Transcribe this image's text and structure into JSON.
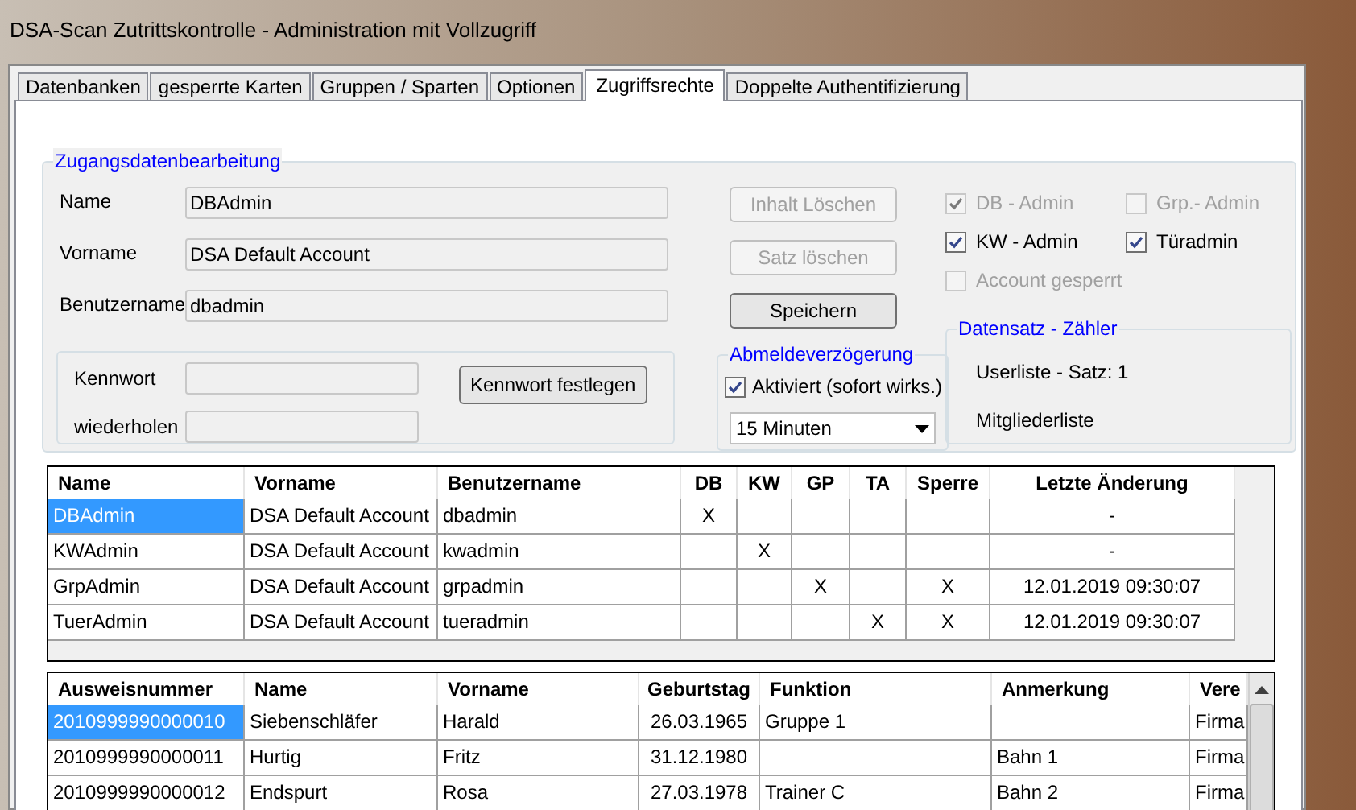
{
  "window": {
    "title": "DSA-Scan Zutrittskontrolle - Administration mit Vollzugriff"
  },
  "tabs": [
    {
      "label": "Datenbanken",
      "selected": false
    },
    {
      "label": "gesperrte Karten",
      "selected": false
    },
    {
      "label": "Gruppen / Sparten",
      "selected": false
    },
    {
      "label": "Optionen",
      "selected": false
    },
    {
      "label": "Zugriffsrechte",
      "selected": true
    },
    {
      "label": "Doppelte Authentifizierung",
      "selected": false
    }
  ],
  "editor": {
    "title": "Zugangsdatenbearbeitung",
    "fields": [
      {
        "label": "Name",
        "value": "DBAdmin"
      },
      {
        "label": "Vorname",
        "value": "DSA Default Account"
      },
      {
        "label": "Benutzername",
        "value": "dbadmin"
      }
    ],
    "password": {
      "fields": [
        {
          "label": "Kennwort"
        },
        {
          "label": "wiederholen"
        }
      ],
      "button": "Kennwort festlegen"
    },
    "buttons": [
      {
        "label": "Inhalt Löschen",
        "disabled": true
      },
      {
        "label": "Satz löschen",
        "disabled": true
      },
      {
        "label": "Speichern",
        "disabled": false
      }
    ],
    "checkboxes": [
      {
        "label": "DB - Admin",
        "checked": true,
        "disabled": true
      },
      {
        "label": "Grp.- Admin",
        "checked": false,
        "disabled": true
      },
      {
        "label": "KW - Admin",
        "checked": true,
        "disabled": false
      },
      {
        "label": "Türadmin",
        "checked": true,
        "disabled": false
      },
      {
        "label": "Account gesperrt",
        "checked": false,
        "disabled": true
      }
    ],
    "logout_delay": {
      "title": "Abmeldeverzögerung",
      "checkbox": {
        "label": "Aktiviert (sofort wirks.)",
        "checked": true
      },
      "dropdown": {
        "value": "15 Minuten"
      }
    },
    "counter": {
      "title": "Datensatz - Zähler",
      "lines": [
        "Userliste - Satz: 1",
        "Mitgliederliste"
      ]
    }
  },
  "users_table": {
    "columns": [
      "Name",
      "Vorname",
      "Benutzername",
      "DB",
      "KW",
      "GP",
      "TA",
      "Sperre",
      "Letzte Änderung"
    ],
    "rows": [
      {
        "selected": true,
        "cells": [
          "DBAdmin",
          "DSA Default Account",
          "dbadmin",
          "X",
          null,
          null,
          null,
          null,
          "-"
        ]
      },
      {
        "selected": false,
        "cells": [
          "KWAdmin",
          "DSA Default Account",
          "kwadmin",
          null,
          "X",
          null,
          null,
          null,
          "-"
        ]
      },
      {
        "selected": false,
        "cells": [
          "GrpAdmin",
          "DSA Default Account",
          "grpadmin",
          null,
          null,
          "X",
          null,
          "X",
          "12.01.2019 09:30:07"
        ]
      },
      {
        "selected": false,
        "cells": [
          "TuerAdmin",
          "DSA Default Account",
          "tueradmin",
          null,
          null,
          null,
          "X",
          "X",
          "12.01.2019 09:30:07"
        ]
      }
    ]
  },
  "members_table": {
    "columns": [
      "Ausweisnummer",
      "Name",
      "Vorname",
      "Geburtstag",
      "Funktion",
      "Anmerkung",
      "Vere"
    ],
    "rows": [
      {
        "selected": true,
        "cells": [
          "2010999990000010",
          "Siebenschläfer",
          "Harald",
          "26.03.1965",
          "Gruppe 1",
          null,
          "Firma"
        ]
      },
      {
        "selected": false,
        "cells": [
          "2010999990000011",
          "Hurtig",
          "Fritz",
          "31.12.1980",
          null,
          "Bahn 1",
          "Firma"
        ]
      },
      {
        "selected": false,
        "cells": [
          "2010999990000012",
          "Endspurt",
          "Rosa",
          "27.03.1978",
          "Trainer C",
          "Bahn 2",
          "Firma"
        ]
      }
    ]
  }
}
